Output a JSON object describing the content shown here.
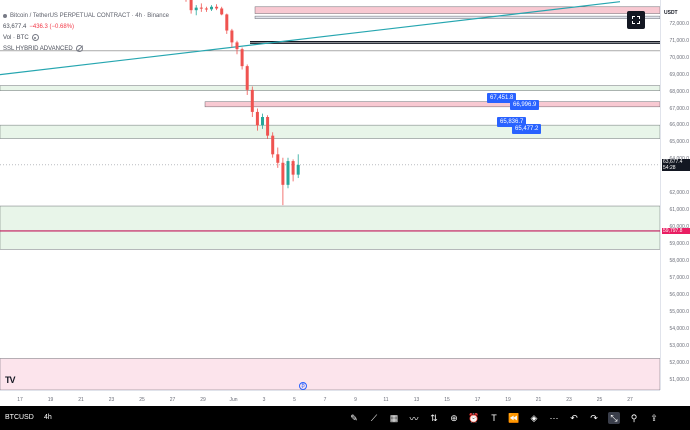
{
  "header": {
    "title": "Bitcoin / TetherUS PERPETUAL CONTRACT · 4h · Binance",
    "price_line": "63,677.4",
    "change_line": "−436.3 (−0.68%)",
    "indicator_1": "Vol · BTC",
    "indicator_2": "SSL HYBRID ADVANCED"
  },
  "price_axis": {
    "currency": "USDT",
    "ticks": [
      "72,000.0",
      "71,000.0",
      "70,000.0",
      "69,000.0",
      "68,000.0",
      "67,000.0",
      "66,000.0",
      "65,000.0",
      "64,000.0",
      "62,000.0",
      "61,000.0",
      "60,000.0",
      "59,000.0",
      "58,000.0",
      "57,000.0",
      "56,000.0",
      "55,000.0",
      "54,000.0",
      "53,000.0",
      "52,000.0",
      "51,000.0"
    ],
    "current_price": "63,677.4",
    "countdown": "54:28",
    "marker_price": "59,797.8",
    "current_color": "#131722",
    "marker_color": "#e91e63"
  },
  "tags": {
    "tag1_a": "67,451.8",
    "tag1_b": "66,996.9",
    "tag2_a": "65,836.7",
    "tag2_b": "65,477.2"
  },
  "time_axis": {
    "labels": [
      "17",
      "19",
      "21",
      "23",
      "25",
      "27",
      "29",
      "Jun",
      "3",
      "5",
      "7",
      "9",
      "11",
      "13",
      "15",
      "17",
      "19",
      "21",
      "23",
      "25",
      "27"
    ]
  },
  "bottom_bar": {
    "symbol": "BTCUSD",
    "interval": "4h",
    "tools": [
      "pencil-icon",
      "trend-icon",
      "grid-icon",
      "pattern-icon",
      "measure-icon",
      "plus-icon",
      "alarm-icon",
      "text-icon",
      "rewind-icon",
      "layers-icon",
      "more-icon",
      "undo-icon",
      "redo-icon",
      "collapse-icon",
      "pin-icon",
      "share-icon"
    ]
  },
  "event_marker": "₿",
  "logo": "TV",
  "colors": {
    "bull": "#26a69a",
    "bear": "#ef5350",
    "trendline": "#26a6b0",
    "zone_green": "#e8f5e9",
    "zone_pink": "#fce4ec",
    "zone_red": "#f8c9d2"
  },
  "chart_data": {
    "type": "candlestick",
    "title": "Bitcoin / TetherUS PERPETUAL CONTRACT · 4h · Binance",
    "xlabel": "",
    "ylabel": "",
    "ylim": [
      50400,
      73400
    ],
    "price_ticks": [
      72000,
      71000,
      70000,
      69000,
      68000,
      67000,
      66000,
      65000,
      64000,
      62000,
      61000,
      60000,
      59000,
      58000,
      57000,
      56000,
      55000,
      54000,
      53000,
      52000,
      51000
    ],
    "horizontal_levels": [
      {
        "value": 73000,
        "color": "#f8c9d2",
        "kind": "zone",
        "to": 72600
      },
      {
        "value": 72450,
        "color": "#e0e3eb",
        "kind": "zone",
        "to": 72300
      },
      {
        "value": 70950,
        "color": "#131722",
        "kind": "line"
      },
      {
        "value": 70850,
        "color": "#131722",
        "kind": "line"
      },
      {
        "value": 68350,
        "color": "#e8f5e9",
        "kind": "zone",
        "to": 68050
      },
      {
        "value": 67400,
        "color": "#f8c9d2",
        "kind": "zone",
        "to": 67100
      },
      {
        "value": 66020,
        "color": "#e8f5e9",
        "kind": "zone",
        "to": 65230
      },
      {
        "value": 61250,
        "color": "#e8f5e9",
        "kind": "zone",
        "to": 58700
      },
      {
        "value": 59780,
        "color": "#c2185b",
        "kind": "line"
      },
      {
        "value": 52260,
        "color": "#fce4ec",
        "kind": "zone",
        "to": 50400
      }
    ],
    "trendline": {
      "from": [
        0,
        69000
      ],
      "to": [
        620,
        73300
      ]
    },
    "candles": [
      {
        "o": 73800,
        "h": 74000,
        "l": 73300,
        "c": 73500
      },
      {
        "o": 73500,
        "h": 73700,
        "l": 72600,
        "c": 72800
      },
      {
        "o": 72800,
        "h": 73100,
        "l": 72500,
        "c": 72950
      },
      {
        "o": 72950,
        "h": 73200,
        "l": 72700,
        "c": 72900
      },
      {
        "o": 72900,
        "h": 73000,
        "l": 72700,
        "c": 72850
      },
      {
        "o": 72850,
        "h": 73100,
        "l": 72750,
        "c": 73000
      },
      {
        "o": 73000,
        "h": 73150,
        "l": 72800,
        "c": 72900
      },
      {
        "o": 72900,
        "h": 73000,
        "l": 72500,
        "c": 72550
      },
      {
        "o": 72550,
        "h": 72600,
        "l": 71400,
        "c": 71600
      },
      {
        "o": 71600,
        "h": 71700,
        "l": 70600,
        "c": 70900
      },
      {
        "o": 70900,
        "h": 71000,
        "l": 70200,
        "c": 70500
      },
      {
        "o": 70500,
        "h": 70600,
        "l": 69300,
        "c": 69500
      },
      {
        "o": 69500,
        "h": 69600,
        "l": 67800,
        "c": 68100
      },
      {
        "o": 68100,
        "h": 68300,
        "l": 66500,
        "c": 66800
      },
      {
        "o": 66800,
        "h": 67000,
        "l": 65700,
        "c": 66000
      },
      {
        "o": 66000,
        "h": 66700,
        "l": 65800,
        "c": 66500
      },
      {
        "o": 66500,
        "h": 66600,
        "l": 65200,
        "c": 65400
      },
      {
        "o": 65400,
        "h": 65600,
        "l": 64100,
        "c": 64300
      },
      {
        "o": 64300,
        "h": 64700,
        "l": 63500,
        "c": 63800
      },
      {
        "o": 63800,
        "h": 64100,
        "l": 61300,
        "c": 62500
      },
      {
        "o": 62500,
        "h": 64100,
        "l": 62300,
        "c": 63900
      },
      {
        "o": 63900,
        "h": 64000,
        "l": 62700,
        "c": 63100
      },
      {
        "o": 63100,
        "h": 64300,
        "l": 62900,
        "c": 63677
      }
    ]
  }
}
